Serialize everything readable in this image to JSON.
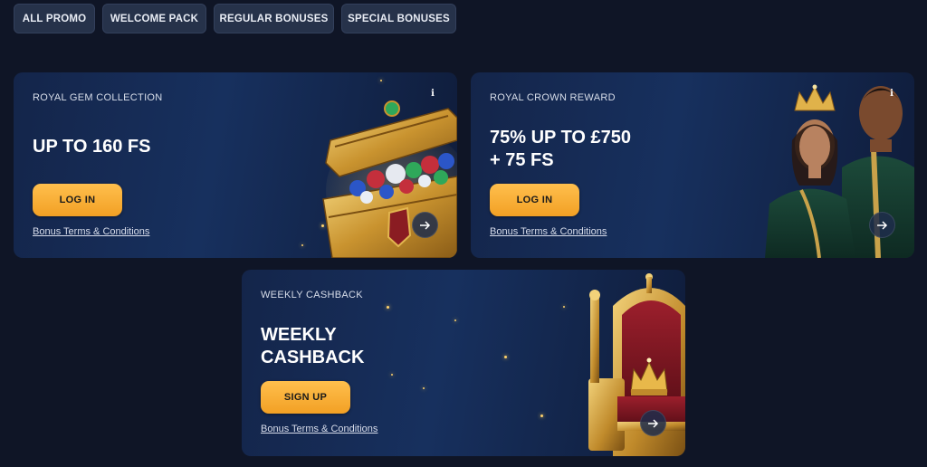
{
  "tabs": [
    {
      "label": "ALL PROMO"
    },
    {
      "label": "WELCOME PACK"
    },
    {
      "label": "REGULAR BONUSES"
    },
    {
      "label": "SPECIAL BONUSES"
    }
  ],
  "cards": [
    {
      "kicker": "ROYAL GEM COLLECTION",
      "title_lines": [
        "UP TO 160 FS"
      ],
      "cta": "LOG IN",
      "terms": "Bonus Terms & Conditions",
      "image": "treasure-chest-with-gems",
      "has_info": true
    },
    {
      "kicker": "ROYAL CROWN REWARD",
      "title_lines": [
        "75% UP TO £750",
        "+ 75 FS"
      ],
      "cta": "LOG IN",
      "terms": "Bonus Terms & Conditions",
      "image": "crowned-royal-couple",
      "has_info": true
    },
    {
      "kicker": "WEEKLY CASHBACK",
      "title_lines": [
        "WEEKLY",
        "CASHBACK"
      ],
      "cta": "SIGN UP",
      "terms": "Bonus Terms & Conditions",
      "image": "golden-throne-with-crown",
      "has_info": false
    }
  ],
  "icons": {
    "info": "info-icon",
    "arrow": "arrow-right-icon"
  },
  "colors": {
    "background": "#0f1526",
    "tab_bg": "#26324a",
    "card_bg": "#17305e",
    "cta": "#f2a024",
    "gold": "#d4a93c"
  }
}
